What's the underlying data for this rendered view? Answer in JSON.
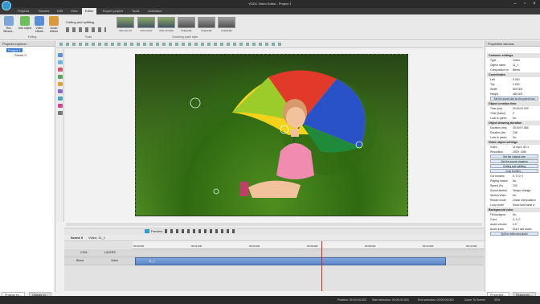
{
  "window": {
    "title": "VSDC Video Editor - Project 1"
  },
  "menu": {
    "tabs": [
      "Projects",
      "Scenes",
      "Edit",
      "View",
      "Editor",
      "Export project",
      "Tools",
      "Activation"
    ],
    "active_index": 4
  },
  "ribbon": {
    "buttons": [
      "Run Wizard...",
      "Add object",
      "Video effects",
      "Audio effects"
    ],
    "editing_label": "Editing",
    "cutting_label": "Cutting and splitting",
    "tools_label": "Tools",
    "styles": [
      "Remove all",
      "Auto levels",
      "Auto contrast",
      "Grayscale",
      "Grayscale",
      "Grayscale"
    ],
    "styles_label": "Choosing quick style"
  },
  "explorer": {
    "title": "Projects explorer",
    "project": "Project 1",
    "scene": "Scene 0"
  },
  "preview": {
    "label": "Preview"
  },
  "timeline": {
    "tabs": [
      "Scene 0",
      "Video: 11_1"
    ],
    "ruler": [
      "00:00.000",
      "00:02.000",
      "00:04.000",
      "00:06.000",
      "00:08.000",
      "00:10.000",
      "00:12.000"
    ],
    "rows": [
      {
        "name": "COM...",
        "type": "LAYERS"
      },
      {
        "name": "Blend",
        "type": "Video"
      }
    ],
    "clip": "11_1"
  },
  "properties": {
    "title": "Properties window",
    "sections": [
      {
        "title": "Common settings",
        "rows": [
          [
            "Type",
            "Video"
          ],
          [
            "Object name",
            "11_1"
          ],
          [
            "Composition m",
            "Blend"
          ]
        ]
      },
      {
        "title": "Coordinates",
        "rows": [
          [
            "Left",
            "0.000"
          ],
          [
            "Top",
            "0.000"
          ],
          [
            "Width",
            "800.000"
          ],
          [
            "Height",
            "480.000"
          ]
        ]
      },
      {
        "title": "Object creation time",
        "rows": [
          [
            "Time (ms)",
            "00:00:00.000"
          ],
          [
            "Time (frame)",
            "0"
          ],
          [
            "Lock to paren",
            "No"
          ]
        ]
      },
      {
        "title": "Object drawing duration",
        "rows": [
          [
            "Duration (ms)",
            "00:00:07.886"
          ],
          [
            "Duration (fra",
            "236"
          ],
          [
            "Lock to paren",
            "No"
          ]
        ]
      },
      {
        "title": "Video object settings",
        "rows": [
          [
            "Video",
            "11.mp4; ID=1"
          ],
          [
            "Resolution",
            "1920; 1080"
          ]
        ]
      }
    ],
    "buttons": [
      "Set the same size as the parent has",
      "Set the original size",
      "Set the source duration",
      "Cutting and splitting",
      "Crop borders..."
    ],
    "more_rows": [
      [
        "Cut borders",
        "0; 0; 0; 0"
      ],
      [
        "Playing backw",
        "No"
      ],
      [
        "Speed (%)",
        "100"
      ],
      [
        "Sound stretch",
        "Tempo change"
      ],
      [
        "Stretch video",
        "No"
      ],
      [
        "Resize mode",
        "Linear interpolation"
      ],
      [
        "Loop mode",
        "Show last frame a"
      ]
    ],
    "bg_section": "Background color",
    "bg_rows": [
      [
        "Fill backgrou",
        "No"
      ],
      [
        "Color",
        "0; 0; 0"
      ],
      [
        "Audio volume",
        "0.0"
      ],
      [
        "Audio track",
        "Don't use audio"
      ]
    ],
    "split_button": "Split to video and audio"
  },
  "bottom_tabs": {
    "left": [
      "Projects ex...",
      "Objects ex..."
    ],
    "right": [
      "Properties ...",
      "Resources ..."
    ]
  },
  "status": {
    "position": "Position: 00:00:04.033",
    "start": "Start selection: 00:00:00.000",
    "end": "End selection: 00:00:00.000",
    "zoom": "Zoom To Screen",
    "zoom_pct": "35%"
  },
  "colors": {
    "accent": "#2e9ad0",
    "clip": "#6b95cf",
    "playhead": "#dd2211"
  }
}
